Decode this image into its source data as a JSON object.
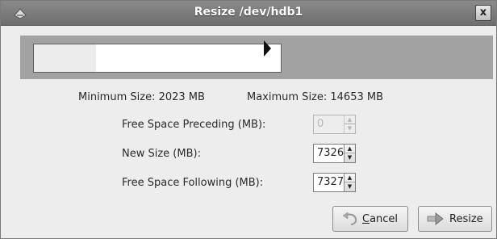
{
  "window": {
    "title": "Resize /dev/hdb1",
    "close_label": "x"
  },
  "partition_bar": {
    "used_fraction": 0.25
  },
  "limits": {
    "minimum": "Minimum Size: 2023 MB",
    "maximum": "Maximum Size: 14653 MB"
  },
  "fields": {
    "free_preceding": {
      "label": "Free Space Preceding (MB):",
      "value": "0",
      "enabled": false
    },
    "new_size": {
      "label": "New Size (MB):",
      "value": "7326",
      "enabled": true
    },
    "free_following": {
      "label": "Free Space Following (MB):",
      "value": "7327",
      "enabled": true
    }
  },
  "buttons": {
    "cancel": "Cancel",
    "resize": "Resize"
  },
  "icons": {
    "title": "drive-icon",
    "cancel": "undo-icon",
    "resize": "resize-arrow-icon"
  }
}
